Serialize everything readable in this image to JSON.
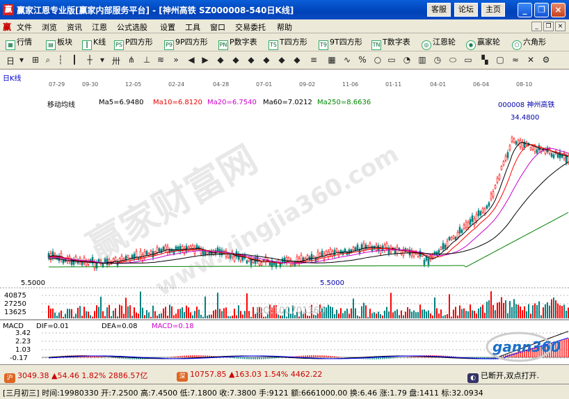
{
  "window": {
    "app_icon": "赢",
    "title": "赢家江恩专业版[赢家内部服务平台] - [神州高铁   SZ000008-540日K线]",
    "buttons": [
      "客服",
      "论坛",
      "主页"
    ]
  },
  "menu": {
    "items": [
      "文件",
      "浏览",
      "资讯",
      "江恩",
      "公式选股",
      "设置",
      "工具",
      "窗口",
      "交易委托",
      "帮助"
    ]
  },
  "toolbar1": {
    "items": [
      "行情",
      "板块",
      "K线",
      "P四方形",
      "9P四方形",
      "P数字表",
      "T四方形",
      "9T四方形",
      "T数字表",
      "江恩轮",
      "赢家轮",
      "六角形"
    ]
  },
  "chart": {
    "period_label": "日K线",
    "indicator_name": "移动均线",
    "ma5": "Ma5=6.9480",
    "ma10": "Ma10=6.8120",
    "ma20": "Ma20=6.7540",
    "ma60": "Ma60=7.0212",
    "ma250": "Ma250=8.6636",
    "stock_label": "000008  神州高铁",
    "high_label": "34.4800",
    "low_label": "5.5000",
    "low_axis": "5.5000",
    "dates": [
      "07-29",
      "09-30",
      "12-05",
      "02-24",
      "04-28",
      "07-01",
      "09-02",
      "11-06",
      "01-11",
      "04-01",
      "06-04",
      "08-10"
    ],
    "volume_ticks": [
      "40875",
      "27250",
      "13625"
    ],
    "macd_label": "MACD",
    "dif": "DIF=0.01",
    "dea": "DEA=0.08",
    "macd": "MACD=0.18",
    "macd_ticks": [
      "3.42",
      "2.23",
      "1.03",
      "-0.17"
    ],
    "watermark": "赢家财富网",
    "watermark_url": "www.yingjia360.com",
    "qq_text": "QQ:100701360",
    "logo_text": "gann360",
    "colors": {
      "candle_up": "#ff0000",
      "candle_down": "#008080",
      "ma5": "#000000",
      "ma10": "#ff0000",
      "ma20": "#cc00cc",
      "ma60": "#000000",
      "ma250": "#008000"
    }
  },
  "index_bar": {
    "sh_icon": "沪",
    "sh": "3049.38 ▲54.46 1.82% 2886.57亿",
    "sz_icon": "深",
    "sz": "10757.85 ▲163.03 1.54% 4462.22",
    "broadcast": "已断开,双点打开."
  },
  "status": {
    "text": "[三月初三] 时间:19980330 开:7.2500 高:7.4500 低:7.1800 收:7.3800 手:9121 额:6661000.00 换:6.46 涨:1.79 盘:1411 标:32.0934"
  }
}
